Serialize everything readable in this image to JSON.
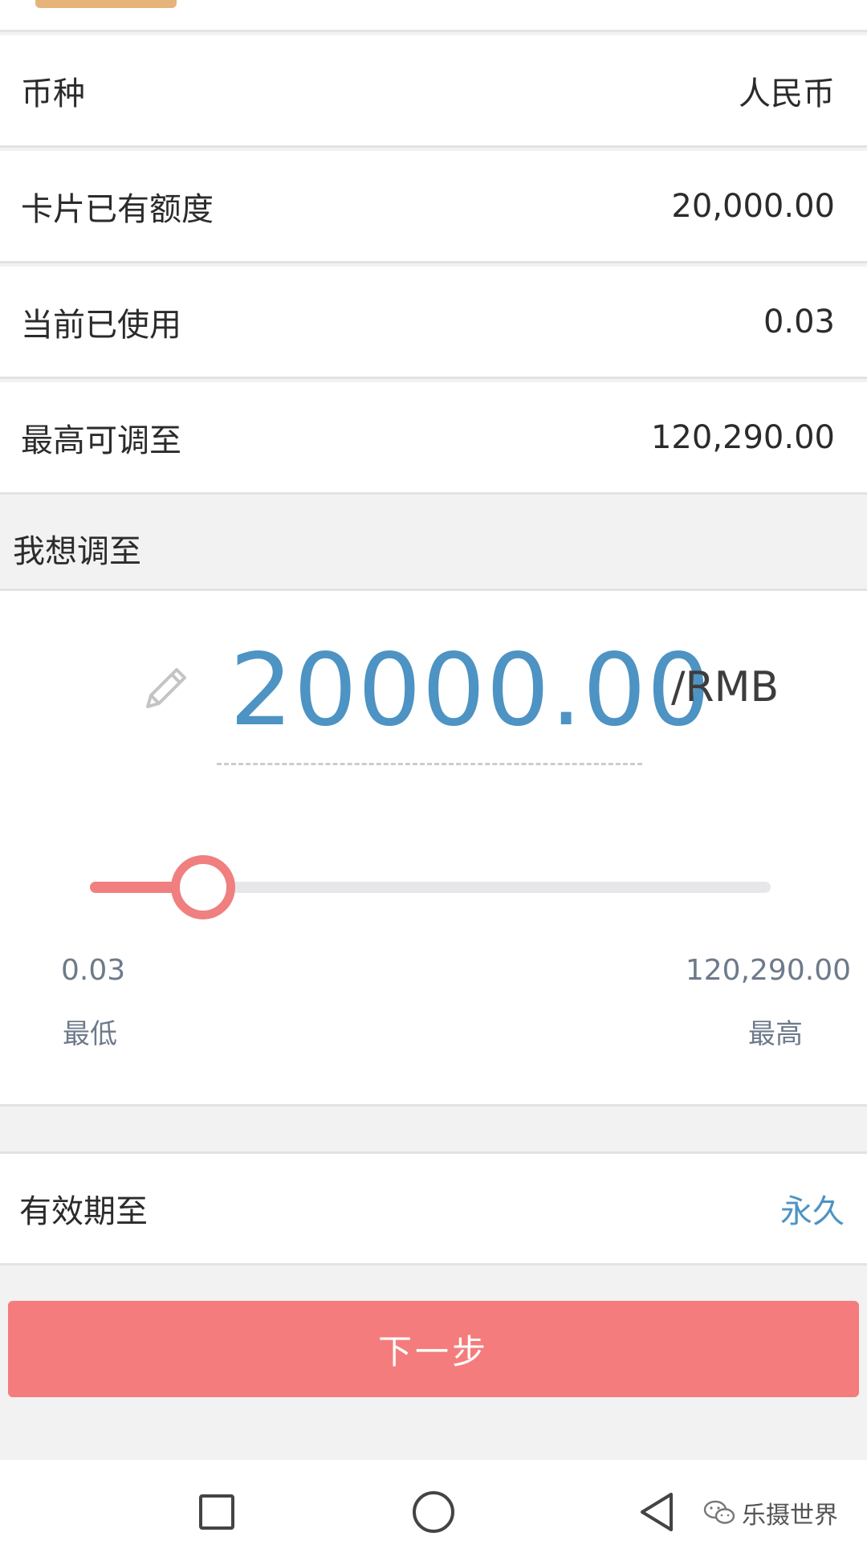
{
  "rows": [
    {
      "label": "币种",
      "value": "人民币"
    },
    {
      "label": "卡片已有额度",
      "value": "20,000.00"
    },
    {
      "label": "当前已使用",
      "value": "0.03"
    },
    {
      "label": "最高可调至",
      "value": "120,290.00"
    }
  ],
  "adjust": {
    "section_title": "我想调至",
    "amount": "20000.00",
    "unit": "/RMB",
    "slider": {
      "min_value": "0.03",
      "min_label": "最低",
      "max_value": "120,290.00",
      "max_label": "最高",
      "fraction": 0.166
    }
  },
  "validity": {
    "label": "有效期至",
    "value": "永久"
  },
  "next_button": {
    "label": "下一步"
  },
  "watermark": {
    "text": "乐摄世界"
  },
  "colors": {
    "accent_blue": "#4d93c3",
    "accent_red": "#f57c7c",
    "slider_red": "#f07f7f"
  },
  "icons": {
    "pencil": "pencil-icon",
    "nav_recent": "square-icon",
    "nav_home": "circle-icon",
    "nav_back": "triangle-back-icon",
    "watermark": "wechat-icon"
  }
}
